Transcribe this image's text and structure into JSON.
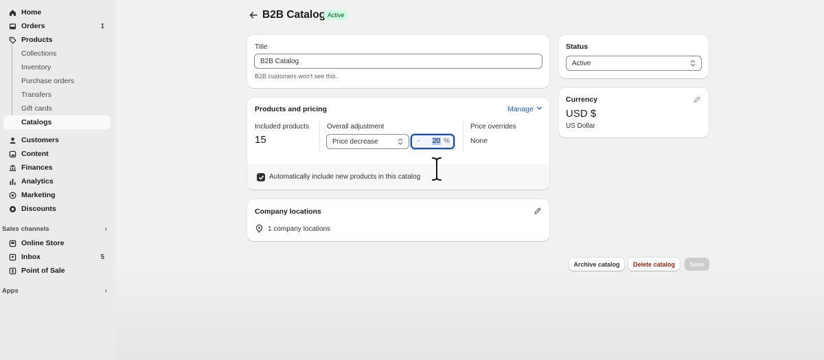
{
  "sidebar": {
    "items": [
      {
        "label": "Home",
        "icon": "home-icon"
      },
      {
        "label": "Orders",
        "icon": "orders-inbox-icon",
        "count": "1"
      },
      {
        "label": "Products",
        "icon": "tag-icon"
      }
    ],
    "product_subitems": [
      "Collections",
      "Inventory",
      "Purchase orders",
      "Transfers",
      "Gift cards",
      "Catalogs"
    ],
    "items2": [
      {
        "label": "Customers",
        "icon": "person-icon"
      },
      {
        "label": "Content",
        "icon": "content-icon"
      },
      {
        "label": "Finances",
        "icon": "bank-icon"
      },
      {
        "label": "Analytics",
        "icon": "bar-chart-icon"
      },
      {
        "label": "Marketing",
        "icon": "target-icon"
      },
      {
        "label": "Discounts",
        "icon": "gear-discount-icon"
      }
    ],
    "sales_channels_label": "Sales channels",
    "channels": [
      {
        "label": "Online Store",
        "icon": "store-icon"
      },
      {
        "label": "Inbox",
        "icon": "inbox-icon",
        "count": "5"
      },
      {
        "label": "Point of Sale",
        "icon": "pos-icon"
      }
    ],
    "apps_label": "Apps"
  },
  "header": {
    "title": "B2B Catalog",
    "status_badge": "Active"
  },
  "title_card": {
    "label": "Title",
    "value": "B2B Catalog",
    "hint": "B2B customers won't see this."
  },
  "pricing_card": {
    "heading": "Products and pricing",
    "manage_label": "Manage",
    "included_label": "Included products",
    "included_value": "15",
    "adjustment_label": "Overall adjustment",
    "adjustment_value": "Price decrease",
    "pct_minus": "-",
    "pct_value": "20",
    "pct_sign": "%",
    "overrides_label": "Price overrides",
    "overrides_value": "None",
    "auto_include_label": "Automatically include new products in this catalog",
    "auto_include_checked": true
  },
  "locations_card": {
    "heading": "Company locations",
    "count_text": "1 company locations"
  },
  "status_card": {
    "heading": "Status",
    "value": "Active"
  },
  "currency_card": {
    "heading": "Currency",
    "code": "USD $",
    "name": "US Dollar"
  },
  "actions": {
    "archive": "Archive catalog",
    "delete": "Delete catalog",
    "save": "Save"
  },
  "colors": {
    "accent": "#1f5199",
    "link": "#1b5ca8",
    "badge_bg": "#cdfee1",
    "badge_text": "#0c5132",
    "critical": "#8e1f0b"
  }
}
